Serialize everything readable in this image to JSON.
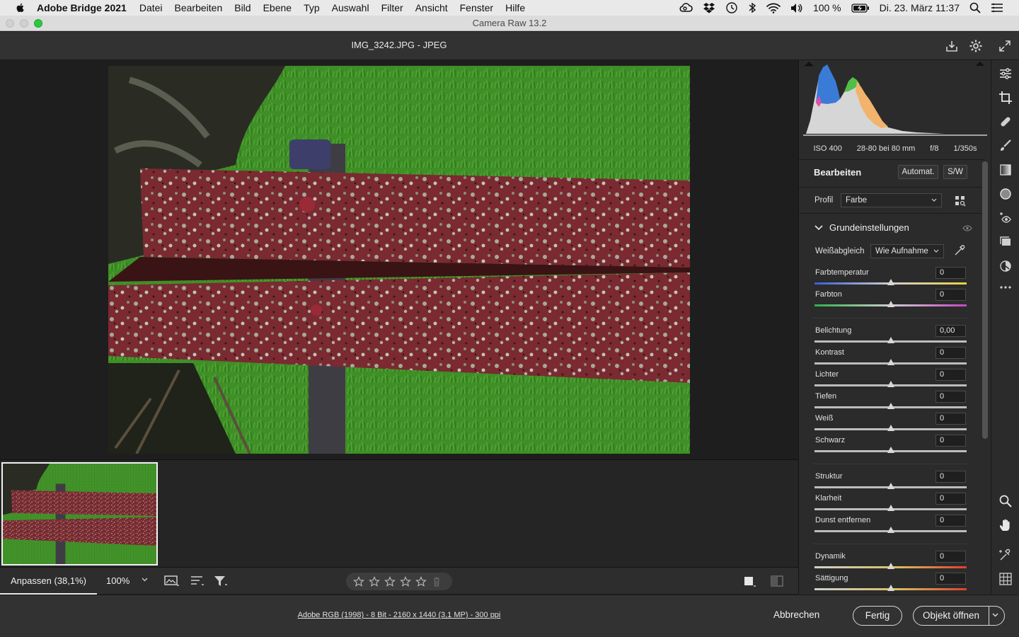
{
  "menubar": {
    "app_name": "Adobe Bridge 2021",
    "items": [
      "Datei",
      "Bearbeiten",
      "Bild",
      "Ebene",
      "Typ",
      "Auswahl",
      "Filter",
      "Ansicht",
      "Fenster",
      "Hilfe"
    ],
    "battery": "100 %",
    "datetime": "Di. 23. März 11:37"
  },
  "window": {
    "title": "Camera Raw 13.2"
  },
  "header": {
    "filename": "IMG_3242.JPG  -  JPEG"
  },
  "toolbar": {
    "zoom_fit": "Anpassen (38,1%)",
    "zoom_percent": "100%",
    "rating": 0,
    "rating_max": 5
  },
  "statusbar": {
    "info_link": "Adobe RGB (1998) - 8 Bit - 2160 x 1440 (3,1 MP) - 300 ppi",
    "cancel": "Abbrechen",
    "done": "Fertig",
    "open": "Objekt öffnen"
  },
  "panel": {
    "exif": {
      "iso": "ISO 400",
      "lens": "28-80 bei 80 mm",
      "aperture": "f/8",
      "shutter": "1/350s"
    },
    "title": "Bearbeiten",
    "auto_button": "Automat.",
    "bw_button": "S/W",
    "profile_label": "Profil",
    "profile_value": "Farbe",
    "section_title": "Grundeinstellungen",
    "wb_label": "Weißabgleich",
    "wb_value": "Wie Aufnahme",
    "sliders": [
      {
        "label": "Farbtemperatur",
        "value": "0",
        "level": 0.5
      },
      {
        "label": "Farbton",
        "value": "0",
        "level": 0.5
      },
      {
        "label": "Belichtung",
        "value": "0,00",
        "level": 0.5
      },
      {
        "label": "Kontrast",
        "value": "0",
        "level": 0.5
      },
      {
        "label": "Lichter",
        "value": "0",
        "level": 0.5
      },
      {
        "label": "Tiefen",
        "value": "0",
        "level": 0.5
      },
      {
        "label": "Weiß",
        "value": "0",
        "level": 0.5
      },
      {
        "label": "Schwarz",
        "value": "0",
        "level": 0.5
      },
      {
        "label": "Struktur",
        "value": "0",
        "level": 0.5
      },
      {
        "label": "Klarheit",
        "value": "0",
        "level": 0.5
      },
      {
        "label": "Dunst entfernen",
        "value": "0",
        "level": 0.5
      },
      {
        "label": "Dynamik",
        "value": "0",
        "level": 0.5
      },
      {
        "label": "Sättigung",
        "value": "0",
        "level": 0.5
      }
    ]
  },
  "colors": {
    "app_bg": "#1e1e1e",
    "panel_bg": "#2b2b2b",
    "window_accent": "#2ac840",
    "fence_red": "#7a2a30",
    "grass_green": "#3e8f26"
  }
}
